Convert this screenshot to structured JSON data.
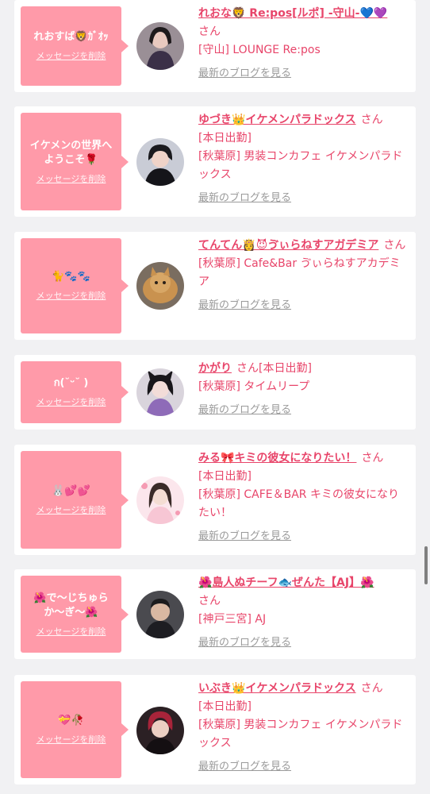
{
  "common": {
    "delete_label": "メッセージを削除",
    "blog_label": "最新のブログを見る",
    "san": "さん"
  },
  "items": [
    {
      "message": "れおすば🦁ｶﾞｵｯ",
      "cast": "れおな🦁 Re:pos[ルポ] -守山-💙💜",
      "suffix": "",
      "shop": "[守山] LOUNGE Re:pos"
    },
    {
      "message": "イケメンの世界へようこそ🌹",
      "cast": "ゆづき👑イケメンパラドックス",
      "suffix": "[本日出勤]",
      "shop": "[秋葉原] 男装コンカフェ イケメンパラドックス"
    },
    {
      "message": "🐈🐾🐾",
      "cast": "てんてん👸😈ゔぃらねすアガデミア",
      "suffix": "",
      "shop": "[秋葉原] Cafe&Bar ゔぃらねすアカデミア"
    },
    {
      "message": "ก(˘ᵕ˘ )",
      "cast": "かがり",
      "suffix": "[本日出勤]",
      "shop": "[秋葉原] タイムリープ"
    },
    {
      "message": "🐰💕💕",
      "cast": "みる🎀キミの彼女になりたい！",
      "suffix": "[本日出勤]",
      "shop": "[秋葉原] CAFE＆BAR キミの彼女になりたい！"
    },
    {
      "message": "🌺で〜じちゅらか〜ぎ〜🌺",
      "cast": "🌺島人ぬチーフ🐟ぜんた【AJ】🌺",
      "suffix": "",
      "shop": "[神戸三宮] AJ"
    },
    {
      "message": "💝🥀",
      "cast": "いぶき👑イケメンパラドックス",
      "suffix": "[本日出勤]",
      "shop": "[秋葉原] 男装コンカフェ イケメンパラドックス"
    }
  ]
}
